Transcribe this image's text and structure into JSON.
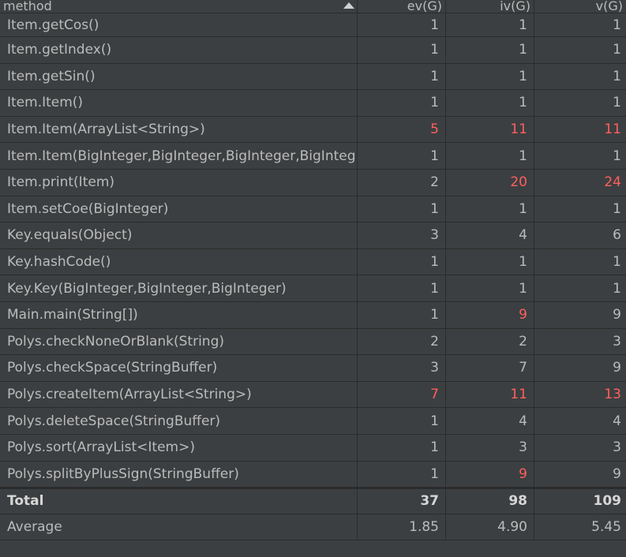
{
  "header": {
    "method": "method",
    "ev": "ev(G)",
    "iv": "iv(G)",
    "v": "v(G)",
    "sort_icon": "sort-ascending-icon"
  },
  "colors": {
    "highlight": "#ff5f5f",
    "text": "#bbbbbb",
    "background": "#3c3f41",
    "grid": "#2b2b2b"
  },
  "rows": [
    {
      "method": "Item.getCos()",
      "ev": "1",
      "iv": "1",
      "v": "1",
      "hot": []
    },
    {
      "method": "Item.getIndex()",
      "ev": "1",
      "iv": "1",
      "v": "1",
      "hot": []
    },
    {
      "method": "Item.getSin()",
      "ev": "1",
      "iv": "1",
      "v": "1",
      "hot": []
    },
    {
      "method": "Item.Item()",
      "ev": "1",
      "iv": "1",
      "v": "1",
      "hot": []
    },
    {
      "method": "Item.Item(ArrayList<String>)",
      "ev": "5",
      "iv": "11",
      "v": "11",
      "hot": [
        "ev",
        "iv",
        "v"
      ]
    },
    {
      "method": "Item.Item(BigInteger,BigInteger,BigInteger,BigInteg",
      "ev": "1",
      "iv": "1",
      "v": "1",
      "hot": []
    },
    {
      "method": "Item.print(Item)",
      "ev": "2",
      "iv": "20",
      "v": "24",
      "hot": [
        "iv",
        "v"
      ]
    },
    {
      "method": "Item.setCoe(BigInteger)",
      "ev": "1",
      "iv": "1",
      "v": "1",
      "hot": []
    },
    {
      "method": "Key.equals(Object)",
      "ev": "3",
      "iv": "4",
      "v": "6",
      "hot": []
    },
    {
      "method": "Key.hashCode()",
      "ev": "1",
      "iv": "1",
      "v": "1",
      "hot": []
    },
    {
      "method": "Key.Key(BigInteger,BigInteger,BigInteger)",
      "ev": "1",
      "iv": "1",
      "v": "1",
      "hot": []
    },
    {
      "method": "Main.main(String[])",
      "ev": "1",
      "iv": "9",
      "v": "9",
      "hot": [
        "iv"
      ]
    },
    {
      "method": "Polys.checkNoneOrBlank(String)",
      "ev": "2",
      "iv": "2",
      "v": "3",
      "hot": []
    },
    {
      "method": "Polys.checkSpace(StringBuffer)",
      "ev": "3",
      "iv": "7",
      "v": "9",
      "hot": []
    },
    {
      "method": "Polys.createItem(ArrayList<String>)",
      "ev": "7",
      "iv": "11",
      "v": "13",
      "hot": [
        "ev",
        "iv",
        "v"
      ]
    },
    {
      "method": "Polys.deleteSpace(StringBuffer)",
      "ev": "1",
      "iv": "4",
      "v": "4",
      "hot": []
    },
    {
      "method": "Polys.sort(ArrayList<Item>)",
      "ev": "1",
      "iv": "3",
      "v": "3",
      "hot": []
    },
    {
      "method": "Polys.splitByPlusSign(StringBuffer)",
      "ev": "1",
      "iv": "9",
      "v": "9",
      "hot": [
        "iv"
      ]
    }
  ],
  "total": {
    "label": "Total",
    "ev": "37",
    "iv": "98",
    "v": "109"
  },
  "average": {
    "label": "Average",
    "ev": "1.85",
    "iv": "4.90",
    "v": "5.45"
  }
}
